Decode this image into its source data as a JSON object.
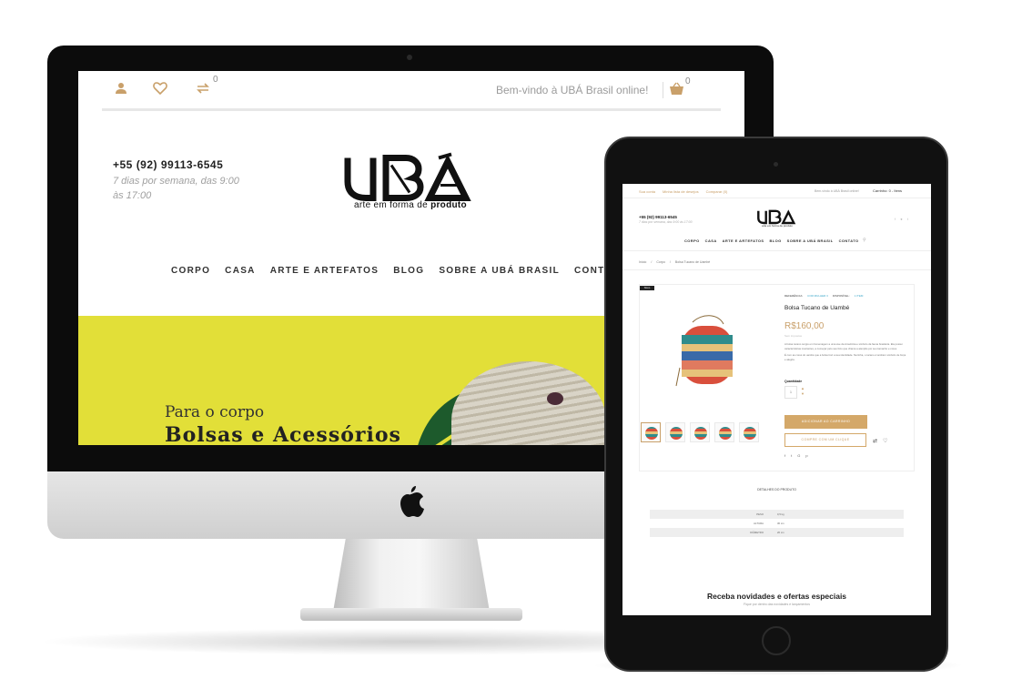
{
  "desktop": {
    "topbar": {
      "compare_count": "0",
      "welcome": "Bem-vindo à UBÁ Brasil online!",
      "cart_count": "0"
    },
    "phone": "+55 (92) 99113-6545",
    "hours": "7 dias por semana, das 9:00 às 17:00",
    "logo": "UBÁ",
    "tagline_regular": "arte em forma de",
    "tagline_bold": "produto",
    "nav": [
      "CORPO",
      "CASA",
      "ARTE E ARTEFATOS",
      "BLOG",
      "SOBRE A UBÁ BRASIL",
      "CONTATO"
    ],
    "hero": {
      "subtitle": "Para o corpo",
      "title": "Bolsas e Acessórios"
    }
  },
  "tablet": {
    "toplinks": [
      "Sua conta",
      "Minha lista de desejos",
      "Comparar (0)"
    ],
    "welcome": "Bem-vindo à UBÁ Brasil online!",
    "cart": "Carrinho: 0 - Itens",
    "phone": "+55 (92) 99113-6545",
    "hours": "7 dias por semana, das 9:00 às 17:00",
    "logo": "UBÁ",
    "tagline": "arte em forma de produto",
    "nav": [
      "CORPO",
      "CASA",
      "ARTE E ARTEFATOS",
      "BLOG",
      "SOBRE A UBÁ BRASIL",
      "CONTATO"
    ],
    "breadcrumb": [
      "Início",
      "/",
      "Corpo",
      "/",
      "Bolsa Tucano de Uambé"
    ],
    "product": {
      "badge": "Novo",
      "reference_label": "REFERÊNCIA:",
      "reference": "COR MULHER 3",
      "availability_label": "DISPONÍVEL:",
      "availability": "1 ITEM",
      "title": "Bolsa Tucano de Uambé",
      "price": "R$160,00",
      "tax": "Sem impostos",
      "description_1": "A bolsa tucano surgiu em homenagem a uma ave da Amazônia e símbolo da fauna brasileira. Ela possui caracte­rísticas marcantes, a começar pelo seu bico que chama a atenção por seu tamanho e cores.",
      "description_2": "É com as cores do uambé que a bolsa traz a sua identidade. Na linha, o tucano é também símbolo de força e alegria.",
      "qty_label": "Quantidade",
      "qty": "1",
      "add_to_cart": "ADICIONAR AO CARRINHO",
      "buy_now": "COMPRE COM UM CLIQUE"
    },
    "details_heading": "DETALHES DO PRODUTO",
    "details": [
      {
        "k": "PESO",
        "v": "0,5 kg"
      },
      {
        "k": "ALTURA",
        "v": "30 cm"
      },
      {
        "k": "DIÂMETRO",
        "v": "20 cm"
      }
    ],
    "newsletter_title": "Receba novidades e ofertas especiais",
    "newsletter_sub": "Fique por dentro das novidades e lançamentos"
  },
  "colors": {
    "accent": "#c9a06a",
    "hero_bg": "#e2df38",
    "device_black": "#0c0c0c"
  }
}
